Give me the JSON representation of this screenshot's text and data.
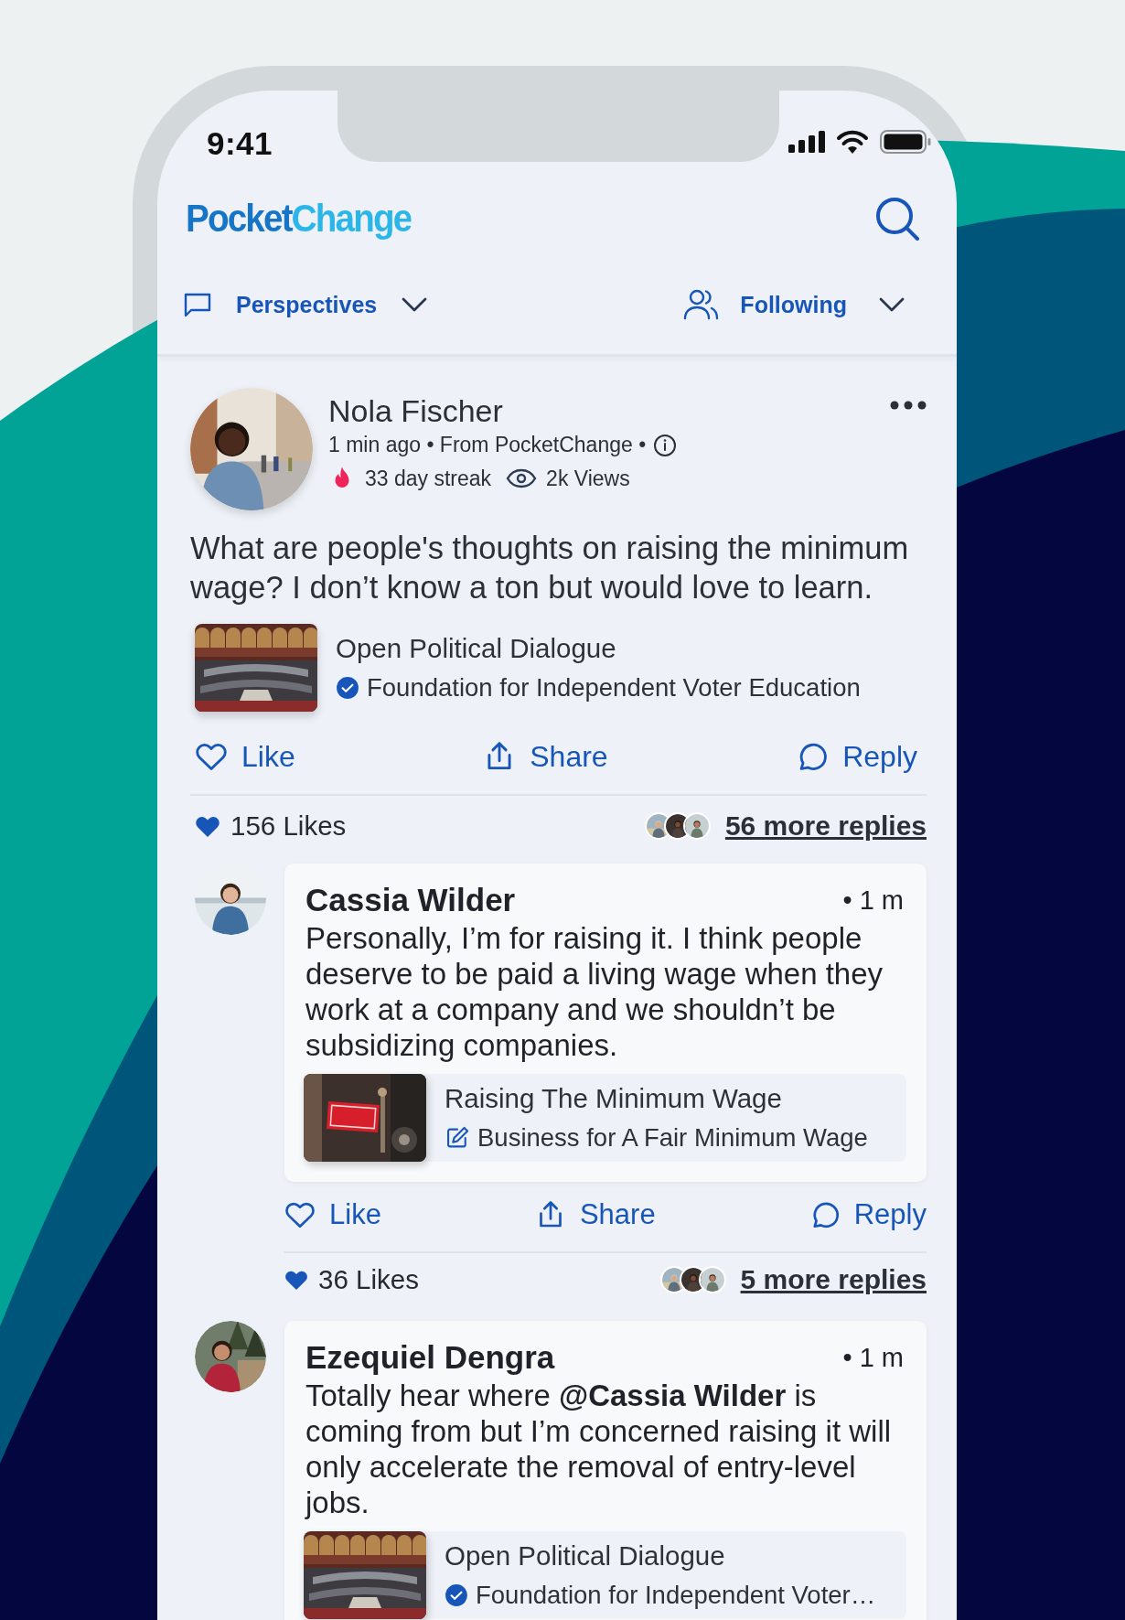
{
  "status_bar": {
    "time": "9:41"
  },
  "header": {
    "logo": "PocketChange"
  },
  "filters": [
    {
      "label": "Perspectives",
      "kind": "feed"
    },
    {
      "label": "Following",
      "kind": "people"
    }
  ],
  "post": {
    "author": "Nola Fischer",
    "meta": "1 min ago • From PocketChange •",
    "streak": "33 day streak",
    "views": "2k Views",
    "text": "What are people's thoughts on raising the minimum wage? I don’t know a ton but would love to learn.",
    "attachment": {
      "title": "Open Political Dialogue",
      "source": "Foundation for Independent Voter Education",
      "verified": true
    },
    "actions": [
      {
        "label": "Like",
        "kind": "like"
      },
      {
        "label": "Share",
        "kind": "share"
      },
      {
        "label": "Reply",
        "kind": "reply"
      }
    ],
    "likes": "156 Likes",
    "more_replies": "56 more replies"
  },
  "comments": [
    {
      "author": "Cassia Wilder",
      "time": "• 1 m",
      "text": "Personally, I’m for raising it. I think people deserve to be paid a living wage when they work at a company and we shouldn’t be subsidizing companies.",
      "attachment": {
        "title": "Raising The Minimum Wage",
        "source": "Business for A Fair Minimum Wage",
        "verified": false
      },
      "actions": [
        {
          "label": "Like",
          "kind": "like"
        },
        {
          "label": "Share",
          "kind": "share"
        },
        {
          "label": "Reply",
          "kind": "reply"
        }
      ],
      "likes": "36 Likes",
      "more_replies": "5 more replies"
    },
    {
      "author": "Ezequiel Dengra",
      "time": "• 1 m",
      "text": "Totally hear where **@Cassia Wilder** is coming from but I’m concerned raising it will only accelerate the removal of entry-level jobs.",
      "attachment": {
        "title": "Open Political Dialogue",
        "source": "Foundation for Independent Voter…",
        "verified": true
      }
    }
  ]
}
